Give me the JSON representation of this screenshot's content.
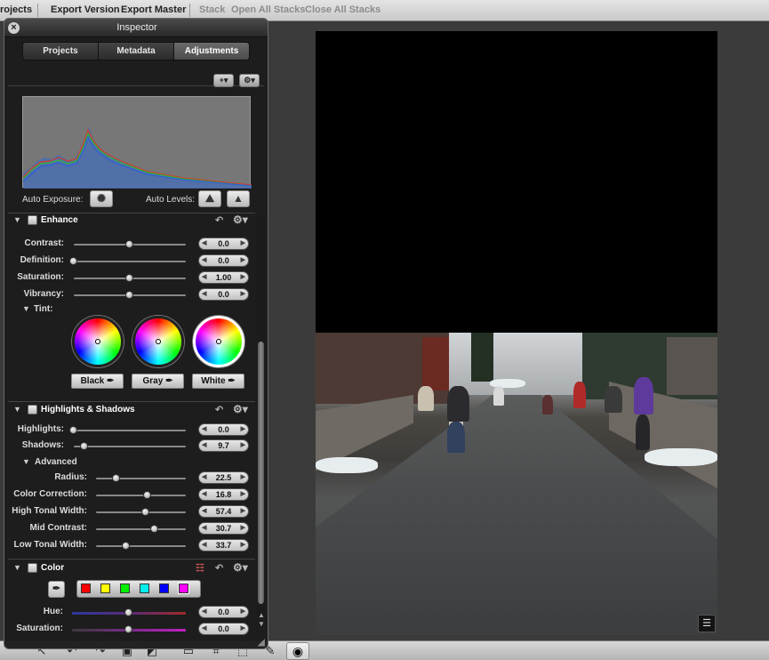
{
  "toolbar": {
    "items": [
      {
        "label": "rojects",
        "enabled": true
      },
      {
        "label": "Export Version",
        "enabled": true
      },
      {
        "label": "Export Master",
        "enabled": true
      },
      {
        "label": "Stack",
        "enabled": false
      },
      {
        "label": "Open All Stacks",
        "enabled": false
      },
      {
        "label": "Close All Stacks",
        "enabled": false
      }
    ]
  },
  "inspector": {
    "title": "Inspector",
    "tabs": [
      "Projects",
      "Metadata",
      "Adjustments"
    ],
    "active_tab": "Adjustments",
    "add_button": "+",
    "gear_button": "⚙",
    "auto_exposure_label": "Auto Exposure:",
    "auto_levels_label": "Auto Levels:"
  },
  "enhance": {
    "title": "Enhance",
    "sliders": [
      {
        "label": "Contrast:",
        "value": "0.0",
        "fraction": 0.5
      },
      {
        "label": "Definition:",
        "value": "0.0",
        "fraction": 0.0
      },
      {
        "label": "Saturation:",
        "value": "1.00",
        "fraction": 0.5
      },
      {
        "label": "Vibrancy:",
        "value": "0.0",
        "fraction": 0.5
      }
    ],
    "tint_label": "Tint:",
    "tint_buttons": [
      "Black",
      "Gray",
      "White"
    ]
  },
  "highlights_shadows": {
    "title": "Highlights & Shadows",
    "sliders": [
      {
        "label": "Highlights:",
        "value": "0.0",
        "fraction": 0.0
      },
      {
        "label": "Shadows:",
        "value": "9.7",
        "fraction": 0.097
      }
    ],
    "advanced_label": "Advanced",
    "advanced_sliders": [
      {
        "label": "Radius:",
        "value": "22.5",
        "fraction": 0.225
      },
      {
        "label": "Color Correction:",
        "value": "16.8",
        "fraction": 0.57
      },
      {
        "label": "High Tonal Width:",
        "value": "57.4",
        "fraction": 0.55
      },
      {
        "label": "Mid Contrast:",
        "value": "30.7",
        "fraction": 0.65
      },
      {
        "label": "Low Tonal Width:",
        "value": "33.7",
        "fraction": 0.34
      }
    ]
  },
  "color": {
    "title": "Color",
    "swatches": [
      "#ff0000",
      "#ffff00",
      "#00ee00",
      "#00eeee",
      "#0000ff",
      "#ff00ff"
    ],
    "selected_swatch": 5,
    "sliders": [
      {
        "label": "Hue:",
        "value": "0.0",
        "fraction": 0.5
      },
      {
        "label": "Saturation:",
        "value": "0.0",
        "fraction": 0.5
      }
    ]
  }
}
